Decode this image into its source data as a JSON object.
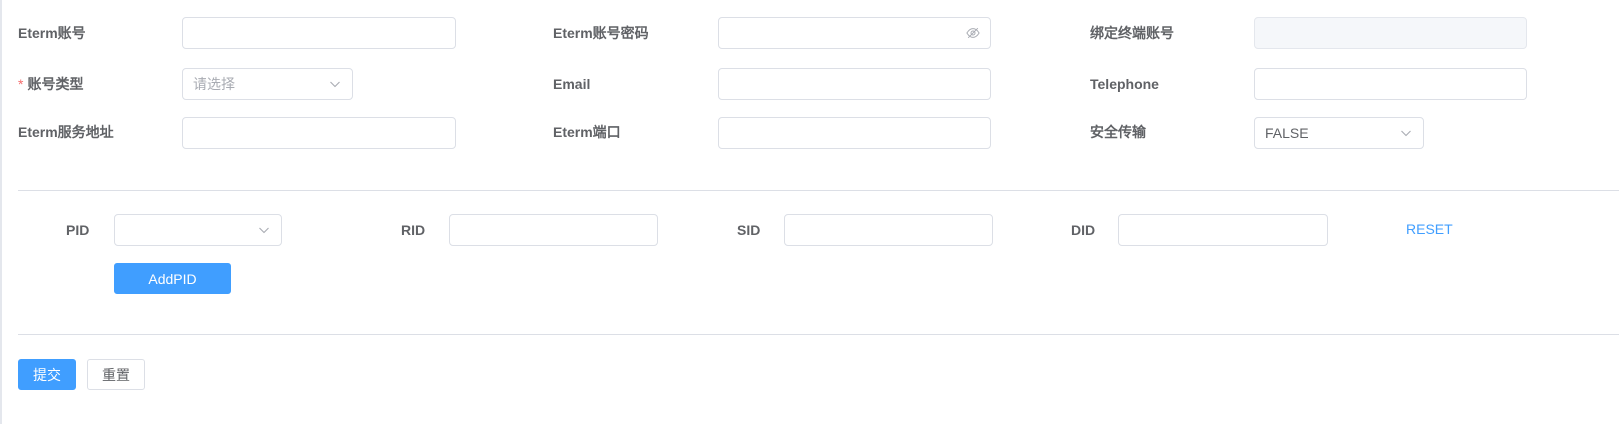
{
  "form": {
    "eterm_account": {
      "label": "Eterm账号",
      "value": ""
    },
    "eterm_password": {
      "label": "Eterm账号密码",
      "value": "",
      "icon": "eye-off-icon"
    },
    "bound_terminal": {
      "label": "绑定终端账号",
      "value": ""
    },
    "account_type": {
      "label": "账号类型",
      "required_mark": "*",
      "placeholder": "请选择"
    },
    "email": {
      "label": "Email",
      "value": ""
    },
    "telephone": {
      "label": "Telephone",
      "value": ""
    },
    "eterm_server": {
      "label": "Eterm服务地址",
      "value": ""
    },
    "eterm_port": {
      "label": "Eterm端口",
      "value": ""
    },
    "secure_transport": {
      "label": "安全传输",
      "value": "FALSE"
    }
  },
  "pid_section": {
    "pid_label": "PID",
    "rid_label": "RID",
    "sid_label": "SID",
    "did_label": "DID",
    "reset_label": "RESET",
    "add_pid_label": "AddPID"
  },
  "actions": {
    "submit_label": "提交",
    "reset_label": "重置"
  },
  "colors": {
    "primary": "#409eff",
    "required": "#f56c6c",
    "border": "#dcdfe6"
  }
}
